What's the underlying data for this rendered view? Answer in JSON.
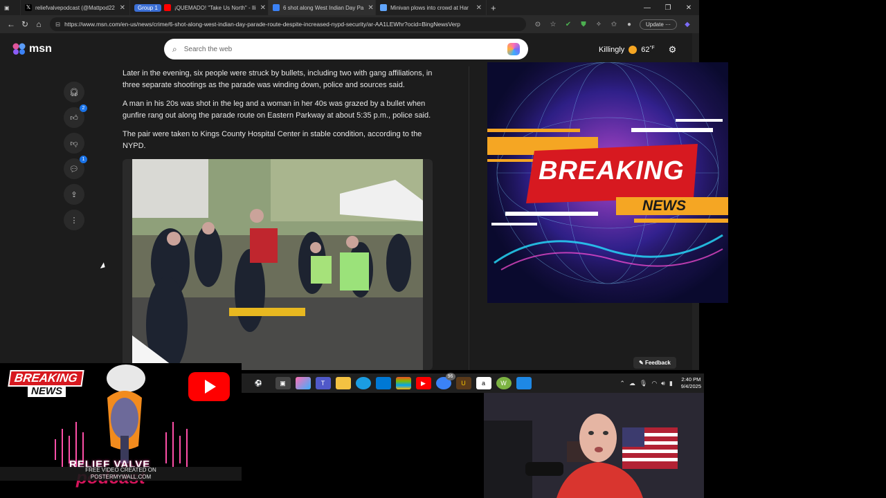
{
  "tabs": [
    {
      "label": "reliefvalvepodcast (@Mattpod22",
      "icon": "x-logo-icon",
      "color": "#ffffff",
      "active": false
    },
    {
      "label": "Group 1",
      "icon": "group-chip",
      "color": "#3b6fd6",
      "active": false
    },
    {
      "label": "¡QUEMADO! \"Take Us North\" - Ili",
      "icon": "youtube-icon",
      "color": "#ff0000",
      "active": false
    },
    {
      "label": "6 shot along West Indian Day Pa",
      "icon": "msn-icon",
      "color": "#3b82f6",
      "active": true
    },
    {
      "label": "Minivan plows into crowd at Har",
      "icon": "news-icon",
      "color": "#60a5fa",
      "active": false
    }
  ],
  "new_tab_label": "+",
  "url": "https://www.msn.com/en-us/news/crime/6-shot-along-west-indian-day-parade-route-despite-increased-nypd-security/ar-AA1LEWhr?ocid=BingNewsVerp",
  "update_button": "Update",
  "msn": {
    "logo_text": "msn",
    "search_placeholder": "Search the web",
    "weather_location": "Killingly",
    "weather_temp": "62",
    "weather_unit": "°F",
    "like_count": "2",
    "comment_count": "1",
    "paragraphs": [
      "Later in the evening, six people were struck by bullets, including two with gang affiliations, in three separate shootings as the parade was winding down, police and sources said.",
      "A man in his 20s was shot in the leg and a woman in her 40s was grazed by a bullet when gunfire rang out along the parade route on Eastern Parkway at about 5:35 p.m., police said.",
      "The pair were taken to Kings County Hospital Center in stable condition, according to the NYPD."
    ],
    "feedback_label": "Feedback"
  },
  "overlay_right": {
    "line1": "BREAKING",
    "line2": "NEWS"
  },
  "overlay_left": {
    "line1": "BREAKING",
    "line2": "NEWS",
    "brand1": "RELIEF VALVE",
    "brand2": "podcast",
    "watermark": "FREE VIDEO CREATED ON\nPOSTERMYWALL.COM"
  },
  "taskbar": {
    "time": "2:40 PM",
    "date": "9/4/2025",
    "notification_count": "96"
  },
  "colors": {
    "accent": "#1a73e8",
    "breaking_red": "#d71920",
    "breaking_orange": "#f5a623"
  }
}
